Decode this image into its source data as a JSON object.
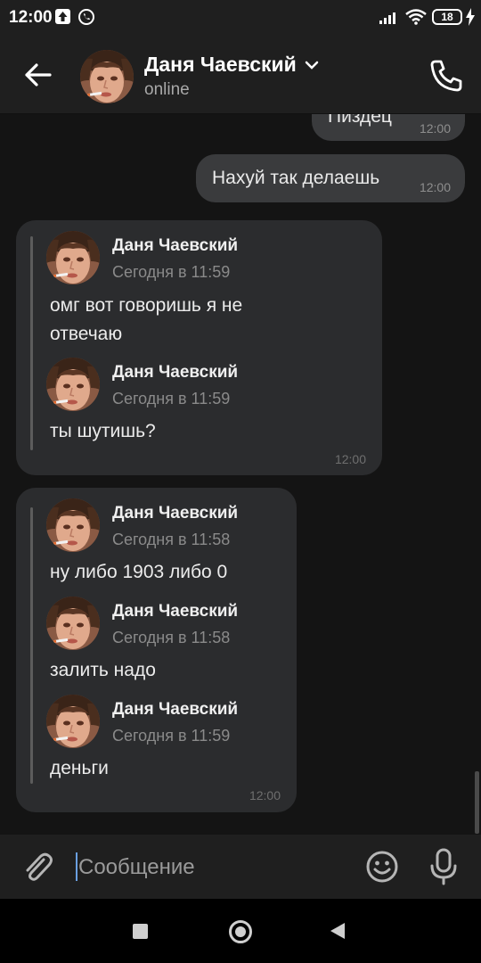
{
  "status_bar": {
    "time": "12:00",
    "battery": "18",
    "icons": [
      "upload-icon",
      "whatsapp-icon",
      "signal-icon",
      "wifi-icon",
      "battery-icon",
      "charging-icon"
    ]
  },
  "header": {
    "name": "Даня Чаевский",
    "status": "online",
    "icons": [
      "back-arrow-icon",
      "chevron-down-icon",
      "phone-icon"
    ]
  },
  "messages": {
    "out1": {
      "text": "Пиздец",
      "time": "12:00"
    },
    "out2": {
      "text": "Нахуй так делаешь",
      "time": "12:00"
    },
    "in1": {
      "time": "12:00",
      "forwards": [
        {
          "name": "Даня Чаевский",
          "date": "Сегодня в 11:59",
          "text_line1": "омг вот говоришь я не",
          "text_line2": "отвечаю"
        },
        {
          "name": "Даня Чаевский",
          "date": "Сегодня в 11:59",
          "text": "ты шутишь?"
        }
      ]
    },
    "in2": {
      "time": "12:00",
      "forwards": [
        {
          "name": "Даня Чаевский",
          "date": "Сегодня в 11:58",
          "text": "ну либо 1903 либо 0"
        },
        {
          "name": "Даня Чаевский",
          "date": "Сегодня в 11:58",
          "text": "залить надо"
        },
        {
          "name": "Даня Чаевский",
          "date": "Сегодня в 11:59",
          "text": "деньги"
        }
      ]
    }
  },
  "composer": {
    "placeholder": "Сообщение",
    "value": "",
    "icons": [
      "paperclip-icon",
      "emoji-icon",
      "microphone-icon"
    ]
  },
  "nav_bar": {
    "icons": [
      "recents-square-icon",
      "home-circle-icon",
      "back-triangle-icon"
    ]
  },
  "colors": {
    "chat_background": "#141414",
    "header_background": "#1f1f1f",
    "outgoing_bubble": "#3a3b3d",
    "incoming_bubble": "#2b2c2e",
    "caret": "#6a9fe0"
  }
}
